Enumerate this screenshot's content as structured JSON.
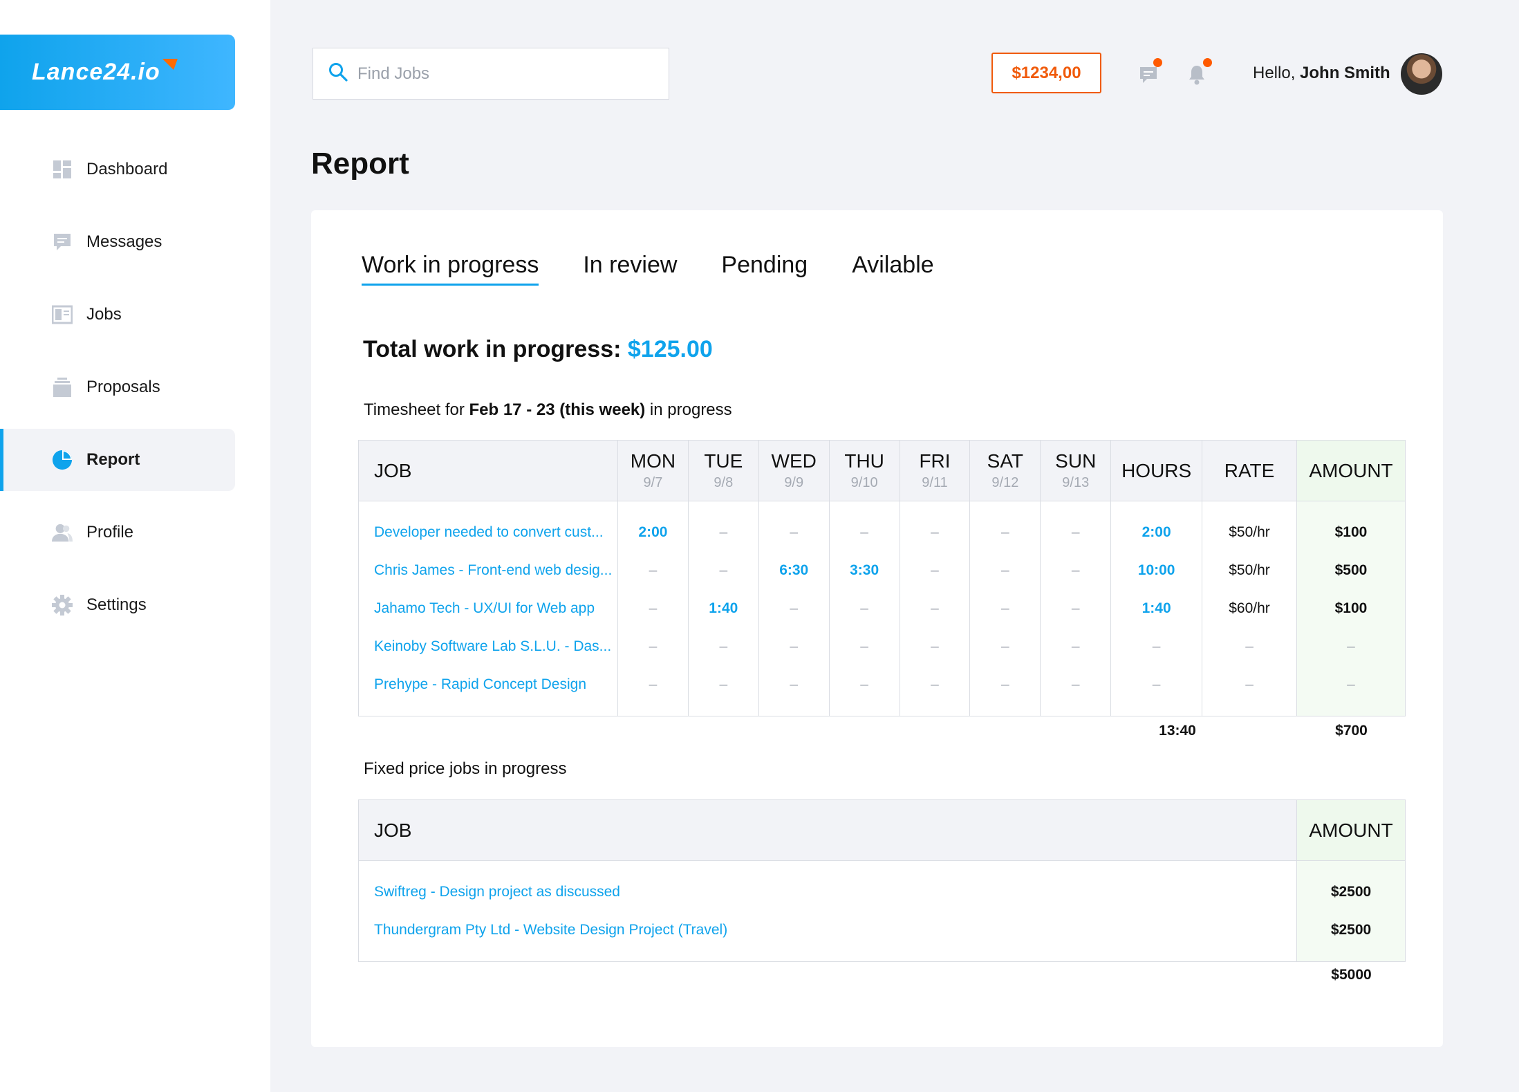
{
  "brand": {
    "logo_text": "Lance24.io"
  },
  "sidebar": {
    "items": [
      {
        "label": "Dashboard",
        "icon": "dashboard-icon"
      },
      {
        "label": "Messages",
        "icon": "message-icon"
      },
      {
        "label": "Jobs",
        "icon": "jobs-icon"
      },
      {
        "label": "Proposals",
        "icon": "proposals-icon"
      },
      {
        "label": "Report",
        "icon": "pie-chart-icon",
        "active": true
      },
      {
        "label": "Profile",
        "icon": "profile-icon"
      },
      {
        "label": "Settings",
        "icon": "gear-icon"
      }
    ]
  },
  "header": {
    "search_placeholder": "Find Jobs",
    "balance": "$1234,00",
    "greeting": "Hello, ",
    "user_name": "John Smith"
  },
  "page": {
    "title": "Report",
    "tabs": [
      "Work in progress",
      "In review",
      "Pending",
      "Avilable"
    ],
    "active_tab": 0,
    "total_label": "Total work in progress: ",
    "total_value": "$125.00",
    "timesheet_prefix": "Timesheet for ",
    "timesheet_period": "Feb 17 - 23 (this week)",
    "timesheet_suffix": " in progress"
  },
  "timesheet": {
    "job_header": "JOB",
    "days": [
      {
        "name": "MON",
        "date": "9/7"
      },
      {
        "name": "TUE",
        "date": "9/8"
      },
      {
        "name": "WED",
        "date": "9/9"
      },
      {
        "name": "THU",
        "date": "9/10"
      },
      {
        "name": "FRI",
        "date": "9/11"
      },
      {
        "name": "SAT",
        "date": "9/12"
      },
      {
        "name": "SUN",
        "date": "9/13"
      }
    ],
    "hours_header": "HOURS",
    "rate_header": "RATE",
    "amount_header": "AMOUNT",
    "rows": [
      {
        "job": "Developer needed to convert cust...",
        "days": [
          "2:00",
          "–",
          "–",
          "–",
          "–",
          "–",
          "–"
        ],
        "hours": "2:00",
        "rate": "$50/hr",
        "amount": "$100"
      },
      {
        "job": "Chris James - Front-end web desig...",
        "days": [
          "–",
          "–",
          "6:30",
          "3:30",
          "–",
          "–",
          "–"
        ],
        "hours": "10:00",
        "rate": "$50/hr",
        "amount": "$500"
      },
      {
        "job": "Jahamo Tech - UX/UI for Web app",
        "days": [
          "–",
          "1:40",
          "–",
          "–",
          "–",
          "–",
          "–"
        ],
        "hours": "1:40",
        "rate": "$60/hr",
        "amount": "$100"
      },
      {
        "job": "Keinoby Software Lab S.L.U. - Das...",
        "days": [
          "–",
          "–",
          "–",
          "–",
          "–",
          "–",
          "–"
        ],
        "hours": "–",
        "rate": "–",
        "amount": "–"
      },
      {
        "job": "Prehype - Rapid Concept Design",
        "days": [
          "–",
          "–",
          "–",
          "–",
          "–",
          "–",
          "–"
        ],
        "hours": "–",
        "rate": "–",
        "amount": "–"
      }
    ],
    "total_hours": "13:40",
    "total_amount": "$700"
  },
  "fixed": {
    "caption": "Fixed price jobs in progress",
    "job_header": "JOB",
    "amount_header": "AMOUNT",
    "rows": [
      {
        "job": "Swiftreg - Design project as discussed",
        "amount": "$2500"
      },
      {
        "job": "Thundergram Pty Ltd - Website Design Project (Travel)",
        "amount": "$2500"
      }
    ],
    "total_amount": "$5000"
  },
  "colors": {
    "accent": "#0fa3ec",
    "balance": "#f05a0a",
    "notification_dot": "#ff5a00"
  }
}
